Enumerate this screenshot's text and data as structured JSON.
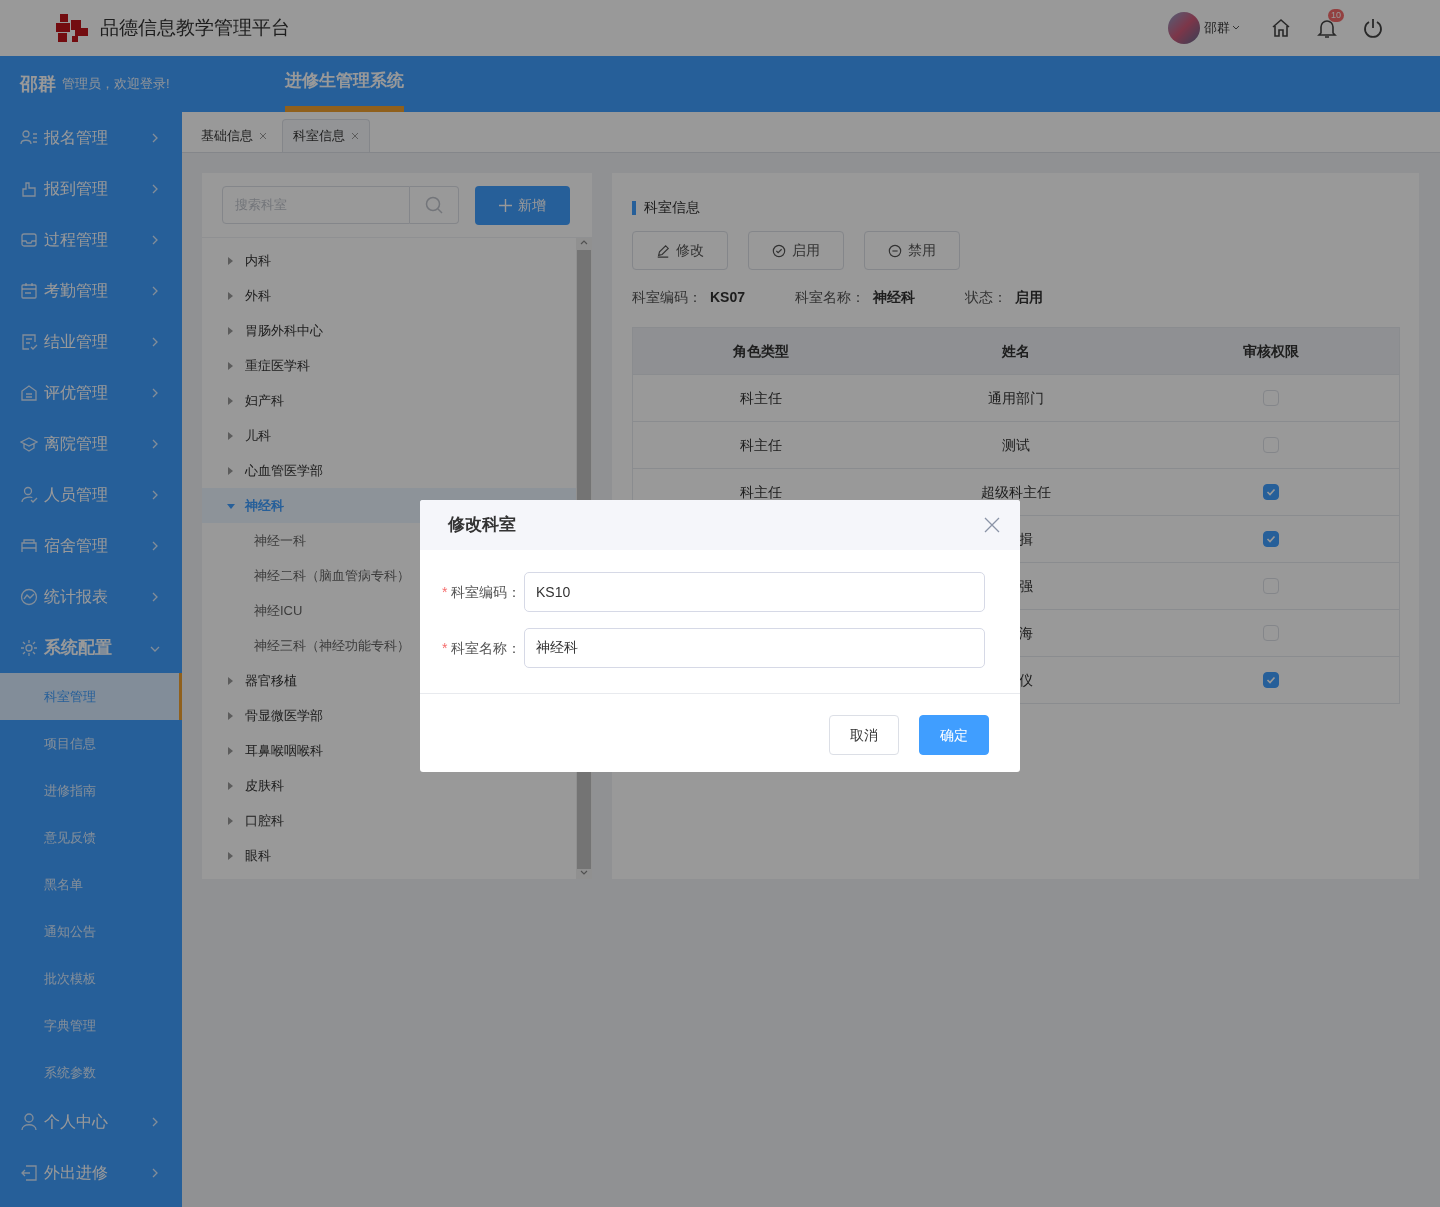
{
  "header": {
    "platform_title": "品德信息教学管理平台",
    "user_name": "邵群",
    "notification_count": "10"
  },
  "top_bar": {
    "user_name": "邵群",
    "greeting": "管理员，欢迎登录!",
    "system_tabs": [
      {
        "label": "进修生管理系统",
        "selected": true
      }
    ]
  },
  "sidebar": {
    "items": [
      {
        "label": "报名管理",
        "expanded": false
      },
      {
        "label": "报到管理",
        "expanded": false
      },
      {
        "label": "过程管理",
        "expanded": false
      },
      {
        "label": "考勤管理",
        "expanded": false
      },
      {
        "label": "结业管理",
        "expanded": false
      },
      {
        "label": "评优管理",
        "expanded": false
      },
      {
        "label": "离院管理",
        "expanded": false
      },
      {
        "label": "人员管理",
        "expanded": false
      },
      {
        "label": "宿舍管理",
        "expanded": false
      },
      {
        "label": "统计报表",
        "expanded": false
      },
      {
        "label": "系统配置",
        "expanded": true,
        "children": [
          {
            "label": "科室管理",
            "selected": true
          },
          {
            "label": "项目信息",
            "selected": false
          },
          {
            "label": "进修指南",
            "selected": false
          },
          {
            "label": "意见反馈",
            "selected": false
          },
          {
            "label": "黑名单",
            "selected": false
          },
          {
            "label": "通知公告",
            "selected": false
          },
          {
            "label": "批次模板",
            "selected": false
          },
          {
            "label": "字典管理",
            "selected": false
          },
          {
            "label": "系统参数",
            "selected": false
          }
        ]
      },
      {
        "label": "个人中心",
        "expanded": false
      },
      {
        "label": "外出进修",
        "expanded": false
      }
    ]
  },
  "tabs": [
    {
      "label": "基础信息",
      "selected": false
    },
    {
      "label": "科室信息",
      "selected": true
    }
  ],
  "dept_panel": {
    "search": {
      "placeholder": "搜索科室"
    },
    "add_button": "新增",
    "tree": [
      {
        "label": "内科",
        "expanded": false,
        "selected": false
      },
      {
        "label": "外科",
        "expanded": false,
        "selected": false
      },
      {
        "label": "胃肠外科中心",
        "expanded": false,
        "selected": false
      },
      {
        "label": "重症医学科",
        "expanded": false,
        "selected": false
      },
      {
        "label": "妇产科",
        "expanded": false,
        "selected": false
      },
      {
        "label": "儿科",
        "expanded": false,
        "selected": false
      },
      {
        "label": "心血管医学部",
        "expanded": false,
        "selected": false
      },
      {
        "label": "神经科",
        "expanded": true,
        "selected": true,
        "children": [
          {
            "label": "神经一科"
          },
          {
            "label": "神经二科（脑血管病专科）"
          },
          {
            "label": "神经ICU"
          },
          {
            "label": "神经三科（神经功能专科）"
          }
        ]
      },
      {
        "label": "器官移植",
        "expanded": false,
        "selected": false
      },
      {
        "label": "骨显微医学部",
        "expanded": false,
        "selected": false
      },
      {
        "label": "耳鼻喉咽喉科",
        "expanded": false,
        "selected": false
      },
      {
        "label": "皮肤科",
        "expanded": false,
        "selected": false
      },
      {
        "label": "口腔科",
        "expanded": false,
        "selected": false
      },
      {
        "label": "眼科",
        "expanded": false,
        "selected": false
      }
    ]
  },
  "detail": {
    "title": "科室信息",
    "buttons": [
      {
        "label": "修改",
        "kind": "edit"
      },
      {
        "label": "启用",
        "kind": "enable"
      },
      {
        "label": "禁用",
        "kind": "disable"
      }
    ],
    "fields": [
      {
        "label": "科室编码：",
        "value": "KS07"
      },
      {
        "label": "科室名称：",
        "value": "神经科"
      },
      {
        "label": "状态：",
        "value": "启用"
      }
    ],
    "table": {
      "columns": [
        "角色类型",
        "姓名",
        "审核权限"
      ],
      "rows": [
        {
          "role": "科主任",
          "name": "通用部门",
          "checked": false
        },
        {
          "role": "科主任",
          "name": "测试",
          "checked": false
        },
        {
          "role": "科主任",
          "name": "超级科主任",
          "checked": true
        },
        {
          "name": "揖",
          "checked": true,
          "kind": "partial"
        },
        {
          "name": "强",
          "checked": false,
          "kind": "partial"
        },
        {
          "name": "海",
          "checked": false,
          "kind": "partial"
        },
        {
          "name": "仪",
          "checked": true,
          "kind": "partial"
        }
      ]
    }
  },
  "dialog": {
    "title": "修改科室",
    "fields": [
      {
        "label": "科室编码：",
        "value": "KS10",
        "required_mark": "*"
      },
      {
        "label": "科室名称：",
        "value": "神经科",
        "required_mark": "*"
      }
    ],
    "buttons": [
      {
        "label": "取消",
        "kind": "default"
      },
      {
        "label": "确定",
        "kind": "primary"
      }
    ]
  }
}
